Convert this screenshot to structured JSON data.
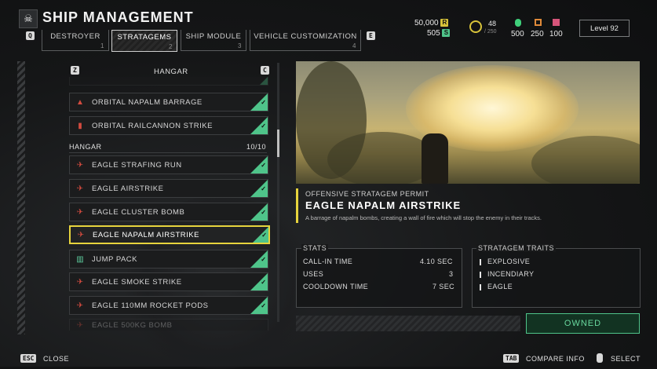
{
  "header": {
    "title": "SHIP MANAGEMENT",
    "key_prev": "Q",
    "key_next": "E",
    "tabs": [
      {
        "label": "DESTROYER",
        "num": "1"
      },
      {
        "label": "STRATAGEMS",
        "num": "2"
      },
      {
        "label": "SHIP MODULE",
        "num": "3"
      },
      {
        "label": "VEHICLE CUSTOMIZATION",
        "num": "4"
      }
    ],
    "active_tab": 1
  },
  "resources": {
    "requisition": "50,000",
    "requisition_icon": "R",
    "super_credits": "505",
    "super_credits_icon": "S",
    "medals": "48",
    "medals_max": "/ 250",
    "samples_common": "500",
    "samples_rare": "250",
    "samples_super": "100",
    "level": "Level 92",
    "colors": {
      "requisition": "#d8c33a",
      "credits": "#4fc48a",
      "common": "#3fd07a",
      "rare": "#e08a3a",
      "super": "#d6557a"
    }
  },
  "list": {
    "header": "HANGAR",
    "key_left": "Z",
    "key_right": "C",
    "section_label": "HANGAR",
    "section_count": "10/10",
    "items_top": [
      {
        "name": "ORBITAL NAPALM BARRAGE",
        "icon": "orbital-icon"
      },
      {
        "name": "ORBITAL RAILCANNON STRIKE",
        "icon": "railcannon-icon"
      }
    ],
    "items": [
      {
        "name": "EAGLE STRAFING RUN",
        "icon": "eagle-icon"
      },
      {
        "name": "EAGLE AIRSTRIKE",
        "icon": "eagle-icon"
      },
      {
        "name": "EAGLE CLUSTER BOMB",
        "icon": "eagle-icon"
      },
      {
        "name": "EAGLE NAPALM AIRSTRIKE",
        "icon": "eagle-icon"
      },
      {
        "name": "JUMP PACK",
        "icon": "jump-pack-icon"
      },
      {
        "name": "EAGLE SMOKE STRIKE",
        "icon": "eagle-icon"
      },
      {
        "name": "EAGLE 110MM ROCKET PODS",
        "icon": "eagle-icon"
      },
      {
        "name": "EAGLE 500KG BOMB",
        "icon": "eagle-icon"
      }
    ],
    "selected_index": 3,
    "check_color": "#4fc48a",
    "selection_color": "#e7d43d"
  },
  "detail": {
    "category": "OFFENSIVE STRATAGEM PERMIT",
    "name": "EAGLE NAPALM AIRSTRIKE",
    "description": "A barrage of napalm bombs, creating a wall of fire which will stop the enemy in their tracks.",
    "stats_title": "STATS",
    "stats": [
      {
        "label": "CALL-IN TIME",
        "value": "4.10 SEC"
      },
      {
        "label": "USES",
        "value": "3"
      },
      {
        "label": "COOLDOWN TIME",
        "value": "7 SEC"
      }
    ],
    "traits_title": "STRATAGEM TRAITS",
    "traits": [
      "EXPLOSIVE",
      "INCENDIARY",
      "EAGLE"
    ],
    "status": "OWNED"
  },
  "footer": {
    "close_key": "ESC",
    "close_label": "CLOSE",
    "compare_key": "TAB",
    "compare_label": "COMPARE INFO",
    "select_label": "SELECT"
  }
}
